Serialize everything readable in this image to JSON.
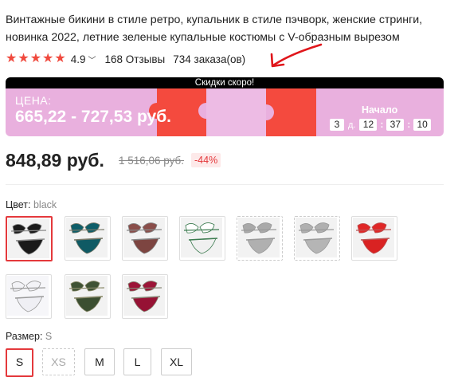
{
  "product": {
    "title": "Винтажные бикини в стиле ретро, купальник в стиле пэчворк, женские стринги, новинка 2022, летние зеленые купальные костюмы с V-образным вырезом",
    "rating": "4.9",
    "reviews": "168 Отзывы",
    "orders": "734 заказа(ов)"
  },
  "banner": {
    "top_text": "Скидки скоро!",
    "price_label": "ЦЕНА:",
    "price_range": "665,22 - 727,53 руб.",
    "start_label": "Начало",
    "timer": {
      "days": "3",
      "days_unit": "д.",
      "hours": "12",
      "minutes": "37",
      "seconds": "10"
    }
  },
  "price": {
    "current": "848,89 руб.",
    "old": "1 516,06 руб.",
    "discount": "-44%"
  },
  "color": {
    "label": "Цвет:",
    "value": "black",
    "options": [
      {
        "name": "black",
        "top": "#1c1c1c",
        "bottom": "#1a1a1a",
        "trim": "#8a8a8a"
      },
      {
        "name": "teal",
        "top": "#0e5e69",
        "bottom": "#0f5a64",
        "trim": "#7a7a6a"
      },
      {
        "name": "brown",
        "top": "#8a4e4a",
        "bottom": "#7d4541",
        "trim": "#888"
      },
      {
        "name": "green-white",
        "top": "#ffffff",
        "bottom": "#f0f0f0",
        "trim": "#3a7a4e"
      },
      {
        "name": "silver-1",
        "top": "#a9a9a9",
        "bottom": "#b0b0b0",
        "trim": "#999"
      },
      {
        "name": "silver-2",
        "top": "#b0b0b0",
        "bottom": "#b5b5b5",
        "trim": "#999"
      },
      {
        "name": "red",
        "top": "#e02727",
        "bottom": "#d92222",
        "trim": "#b55"
      },
      {
        "name": "white",
        "top": "#f3f3f7",
        "bottom": "#efeff4",
        "trim": "#9a9a9a"
      },
      {
        "name": "olive",
        "top": "#3f5234",
        "bottom": "#3c4f31",
        "trim": "#8a8a6a"
      },
      {
        "name": "burgundy",
        "top": "#9c1538",
        "bottom": "#961234",
        "trim": "#887"
      }
    ]
  },
  "size": {
    "label": "Размер:",
    "value": "S",
    "options": [
      "S",
      "XS",
      "M",
      "L",
      "XL"
    ]
  },
  "colors": {
    "accent": "#e4393c",
    "star": "#f0493d",
    "banner_bg": "#e9b0de",
    "puzzle": "#f44a3e"
  }
}
